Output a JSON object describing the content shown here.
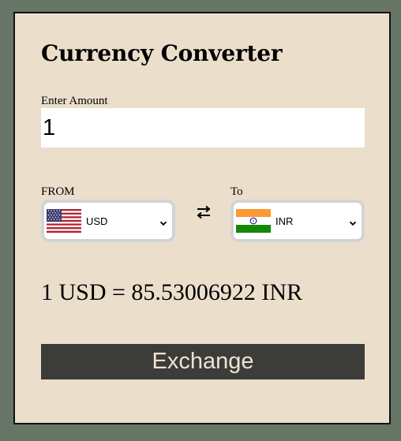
{
  "title": "Currency Converter",
  "amount": {
    "label": "Enter Amount",
    "value": "1"
  },
  "from": {
    "label": "FROM",
    "selected": "USD",
    "flag_icon": "us-flag-icon"
  },
  "to": {
    "label": "To",
    "selected": "INR",
    "flag_icon": "india-flag-icon"
  },
  "swap_icon": "swap-arrows-icon",
  "result": "1 USD = 85.53006922 INR",
  "exchange_button": "Exchange",
  "colors": {
    "page_background": "#667566",
    "card_background": "#ebdfcc",
    "button_background": "#3c3c38",
    "button_text": "#eee4d4",
    "select_border": "#d3d3d6"
  }
}
